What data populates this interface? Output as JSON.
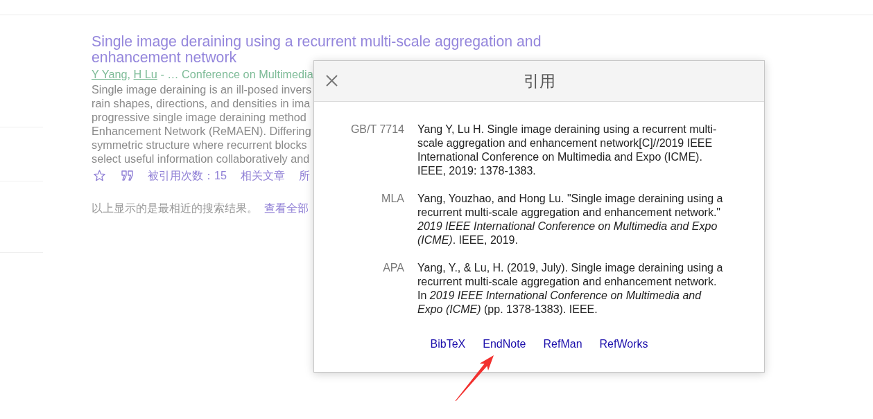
{
  "result": {
    "title": "Single image deraining using a recurrent multi-scale aggregation and enhancement network",
    "byline": {
      "authors": [
        "Y Yang",
        "H Lu"
      ],
      "separator": ",",
      "source": "- … Conference on Multimedia"
    },
    "abstract_lines": [
      "Single image deraining is an ill-posed invers",
      "rain shapes, directions, and densities in ima",
      "progressive single image deraining method",
      "Enhancement Network (ReMAEN). Differing",
      "symmetric structure where recurrent blocks",
      "select useful information collaboratively and"
    ],
    "actions": [
      {
        "kind": "star"
      },
      {
        "kind": "cite"
      },
      {
        "kind": "link",
        "text": "被引用次数：15"
      },
      {
        "kind": "link",
        "text": "相关文章"
      },
      {
        "kind": "link",
        "text": "所"
      }
    ]
  },
  "note": {
    "text": "以上显示的是最相近的搜索结果。",
    "link": "查看全部"
  },
  "dialog": {
    "title": "引用",
    "citations": [
      {
        "style": "GB/T 7714",
        "text": "Yang Y, Lu H. Single image deraining using a recurrent multi-scale aggregation and enhancement network[C]//2019 IEEE International Conference on Multimedia and Expo (ICME). IEEE, 2019: 1378-1383."
      },
      {
        "style": "MLA",
        "text": "Yang, Youzhao, and Hong Lu. \"Single image deraining using a recurrent multi-scale aggregation and enhancement network.\" *2019 IEEE International Conference on Multimedia and Expo (ICME)*. IEEE, 2019."
      },
      {
        "style": "APA",
        "text": "Yang, Y., & Lu, H. (2019, July). Single image deraining using a recurrent multi-scale aggregation and enhancement network. In *2019 IEEE International Conference on Multimedia and Expo (ICME)* (pp. 1378-1383). IEEE."
      }
    ],
    "exports": [
      "BibTeX",
      "EndNote",
      "RefMan",
      "RefWorks"
    ]
  }
}
